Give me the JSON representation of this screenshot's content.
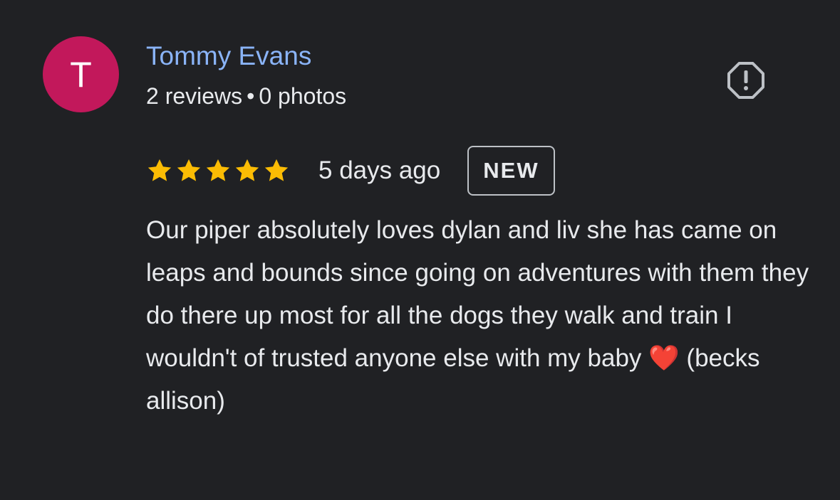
{
  "review": {
    "author": {
      "initial": "T",
      "name": "Tommy Evans",
      "reviews_count": "2 reviews",
      "separator": "•",
      "photos_count": "0 photos",
      "avatar_color": "#c2185b",
      "name_color": "#8ab4f8"
    },
    "rating": {
      "stars": 5,
      "max_stars": 5,
      "star_color": "#fbbc04"
    },
    "date": "5 days ago",
    "badge": "NEW",
    "text": "Our piper absolutely loves dylan and liv she has came on leaps and bounds since going on adventures with them they do there up most for all the dogs they walk and train I wouldn't of trusted anyone else with my baby ❤️ (becks allison)",
    "report_icon": "report-octagon-icon"
  }
}
